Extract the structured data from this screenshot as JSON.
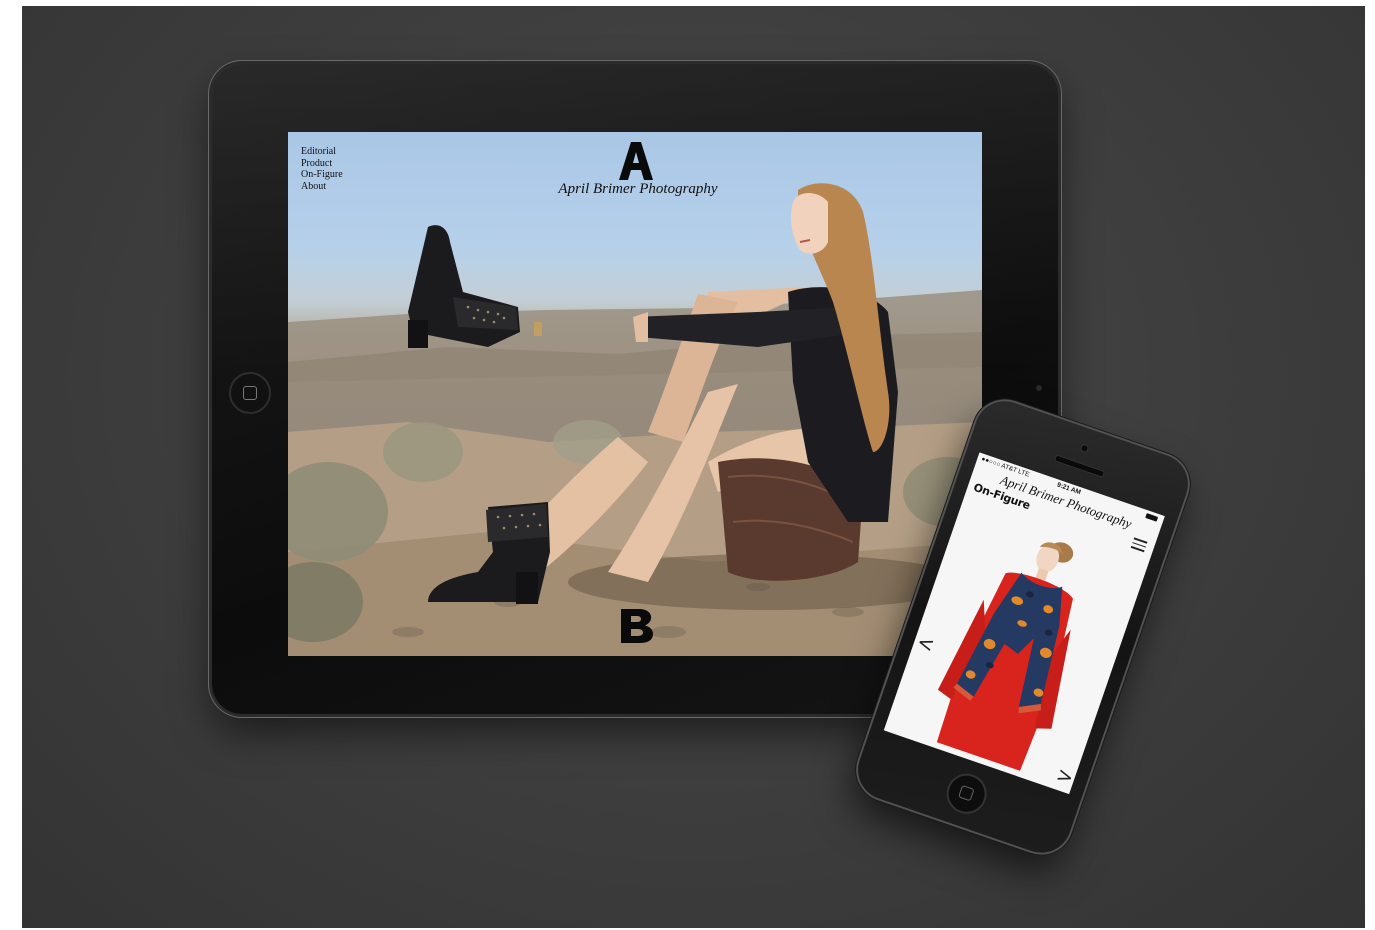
{
  "site": {
    "title": "April Brimer Photography",
    "logo_top": "A",
    "logo_bottom": "B"
  },
  "ipad": {
    "nav": [
      "Editorial",
      "Product",
      "On-Figure",
      "About"
    ]
  },
  "iphone": {
    "status": {
      "carrier": "●●○○○ AT&T LTE",
      "time": "9:21 AM"
    },
    "title": "April Brimer Photography",
    "section": "On-Figure",
    "prev": "<",
    "next": ">"
  },
  "colors": {
    "background": "#3d3d3d",
    "device_frame": "#111111",
    "phone_screen": "#f6f6f6",
    "coat_red": "#d9231d",
    "scarf_blue": "#243a63",
    "scarf_orange": "#e28a2b"
  }
}
